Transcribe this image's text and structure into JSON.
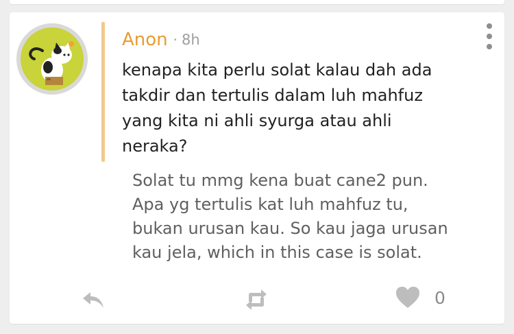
{
  "post": {
    "author": "Anon",
    "separator": "·",
    "time": "8h",
    "question": "kenapa kita perlu solat kalau dah ada\ntakdir dan tertulis dalam luh mahfuz\nyang kita ni ahli syurga atau ahli\nneraka?",
    "answer": "Solat tu mmg kena buat cane2 pun.\nApa yg tertulis kat luh mahfuz tu,\nbukan urusan kau. So kau jaga urusan\nkau jela, which in this case is solat.",
    "like_count": "0"
  },
  "colors": {
    "author": "#e89c33",
    "accent_bar": "#f3c98a",
    "avatar_bg": "#c9d33a",
    "icon": "#bdbdbd",
    "menu": "#8e8e8e"
  },
  "icons": {
    "avatar": "cat-in-box-avatar",
    "menu": "more-vertical-icon",
    "reply": "reply-arrow-icon",
    "repost": "repost-icon",
    "like": "heart-icon"
  }
}
